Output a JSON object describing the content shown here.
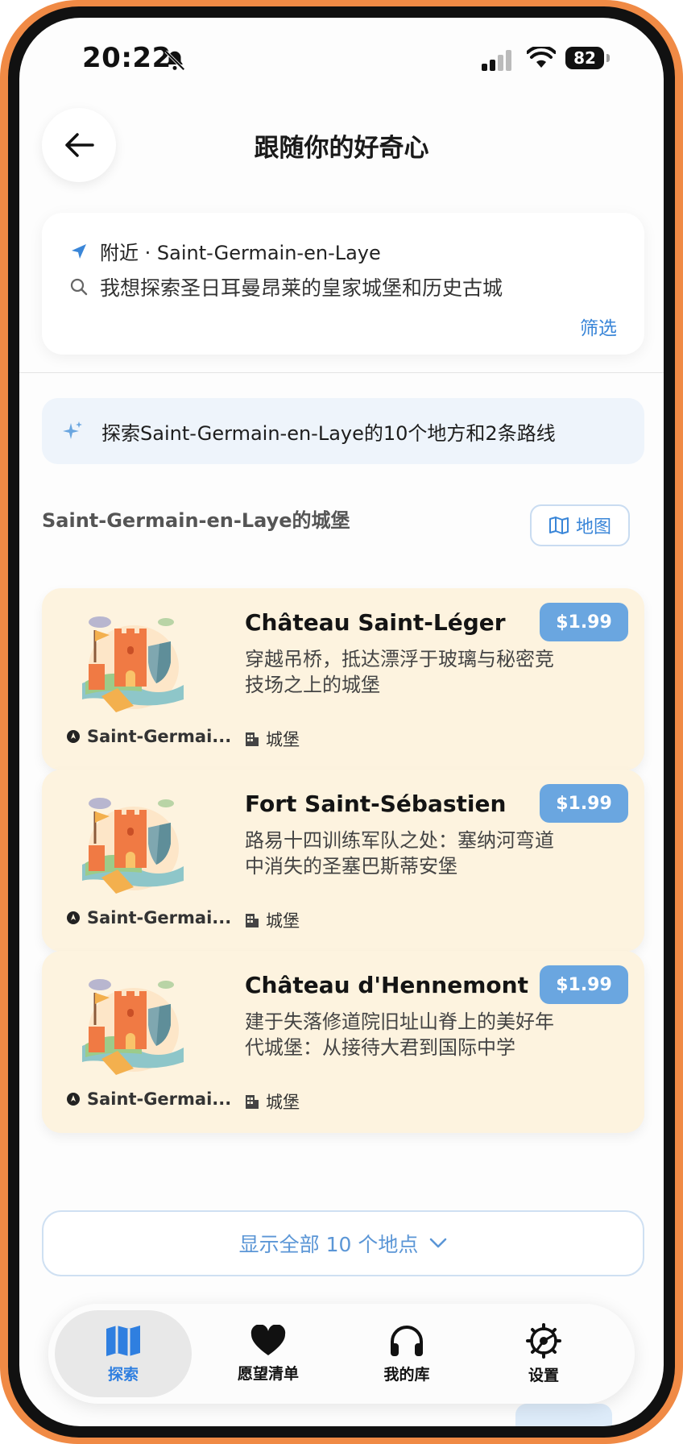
{
  "status_bar": {
    "time": "20:22",
    "battery": "82"
  },
  "header": {
    "title": "跟随你的好奇心"
  },
  "search": {
    "location_label": "附近 · Saint-Germain-en-Laye",
    "query": "我想探索圣日耳曼昂莱的皇家城堡和历史古城",
    "filter_label": "筛选"
  },
  "summary": {
    "text": "探索Saint-Germain-en-Laye的10个地方和2条路线"
  },
  "section": {
    "title": "Saint-Germain-en-Laye的城堡",
    "map_label": "地图"
  },
  "places": [
    {
      "title": "Château Saint-Léger",
      "desc": "穿越吊桥，抵达漂浮于玻璃与秘密竞技场之上的城堡",
      "price": "$1.99",
      "location": "Saint-Germai...",
      "category": "城堡"
    },
    {
      "title": "Fort Saint-Sébastien",
      "desc": "路易十四训练军队之处：塞纳河弯道中消失的圣塞巴斯蒂安堡",
      "price": "$1.99",
      "location": "Saint-Germai...",
      "category": "城堡"
    },
    {
      "title": "Château d'Hennemont",
      "desc": "建于失落修道院旧址山脊上的美好年代城堡：从接待大君到国际中学",
      "price": "$1.99",
      "location": "Saint-Germai...",
      "category": "城堡"
    }
  ],
  "show_all": {
    "label": "显示全部 10 个地点"
  },
  "tabs": [
    {
      "label": "探索",
      "icon": "map-icon",
      "active": true
    },
    {
      "label": "愿望清单",
      "icon": "heart-icon",
      "active": false
    },
    {
      "label": "我的库",
      "icon": "headphones-icon",
      "active": false
    },
    {
      "label": "设置",
      "icon": "gear-icon",
      "active": false
    }
  ],
  "colors": {
    "accent": "#3a86d8",
    "card_bg": "#fdf3df",
    "price_bg": "#6aa6e0",
    "frame": "#f08a45"
  }
}
